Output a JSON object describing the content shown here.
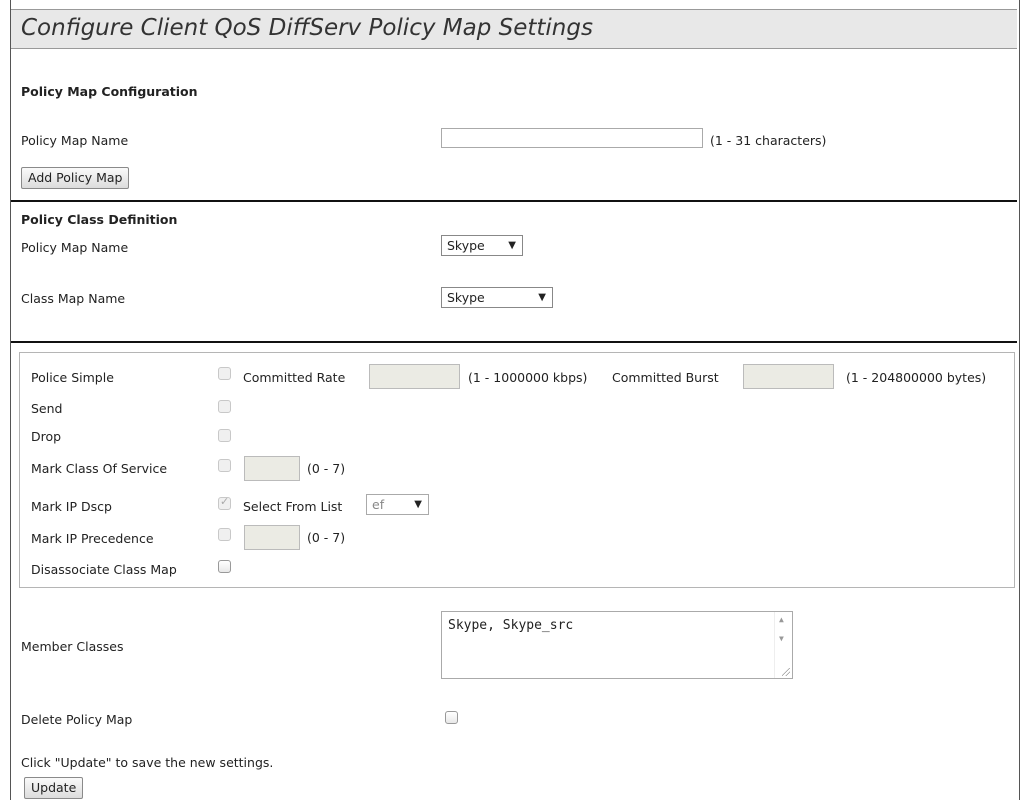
{
  "page": {
    "title": "Configure Client QoS DiffServ Policy Map Settings"
  },
  "policy_map_config": {
    "heading": "Policy Map Configuration",
    "name_label": "Policy Map Name",
    "name_value": "",
    "name_hint": "(1 - 31 characters)",
    "add_button": "Add Policy Map"
  },
  "policy_class_def": {
    "heading": "Policy Class Definition",
    "policy_map_label": "Policy Map Name",
    "policy_map_selected": "Skype",
    "class_map_label": "Class Map Name",
    "class_map_selected": "Skype"
  },
  "actions": {
    "police_simple": {
      "label": "Police Simple",
      "committed_rate_label": "Committed Rate",
      "committed_rate_hint": "(1 - 1000000 kbps)",
      "committed_burst_label": "Committed Burst",
      "committed_burst_hint": "(1 - 204800000 bytes)"
    },
    "send": {
      "label": "Send"
    },
    "drop": {
      "label": "Drop"
    },
    "mark_cos": {
      "label": "Mark Class Of Service",
      "hint": "(0 - 7)"
    },
    "mark_dscp": {
      "label": "Mark IP Dscp",
      "select_label": "Select From List",
      "selected": "ef",
      "checked": true
    },
    "mark_precedence": {
      "label": "Mark IP Precedence",
      "hint": "(0 - 7)"
    },
    "disassociate": {
      "label": "Disassociate Class Map"
    }
  },
  "member_classes": {
    "label": "Member Classes",
    "value": "Skype, Skype_src"
  },
  "delete_policy_map": {
    "label": "Delete Policy Map"
  },
  "footer": {
    "note": "Click \"Update\" to save the new settings.",
    "update_button": "Update"
  }
}
